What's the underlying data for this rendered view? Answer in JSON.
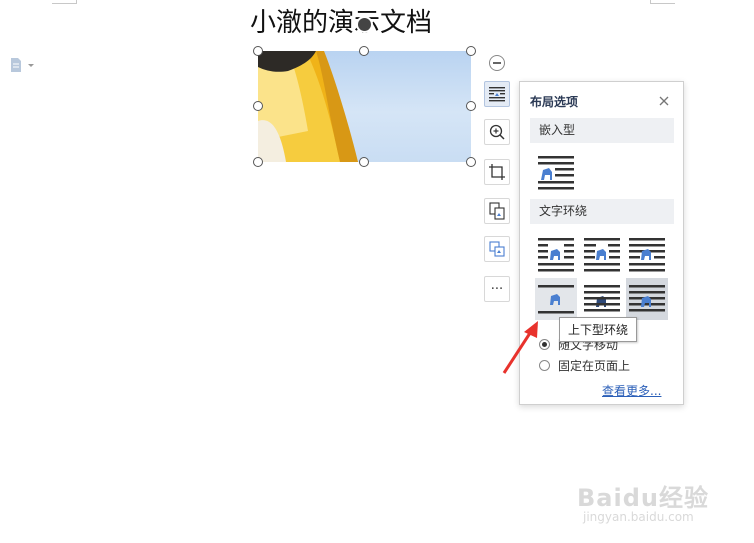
{
  "document": {
    "title": "小澈的演示文档"
  },
  "image_toolbar": {
    "tools": [
      {
        "name": "layout-options",
        "icon": "wrap-text-icon",
        "active": true
      },
      {
        "name": "zoom",
        "icon": "zoom-in-icon"
      },
      {
        "name": "crop",
        "icon": "crop-icon"
      },
      {
        "name": "image-to-text",
        "icon": "image-convert-icon"
      },
      {
        "name": "replace-image",
        "icon": "replace-image-icon"
      },
      {
        "name": "more",
        "icon": "more-icon",
        "label": "···"
      }
    ]
  },
  "layout_panel": {
    "title": "布局选项",
    "inline_section": "嵌入型",
    "wrap_section": "文字环绕",
    "radio_move_with_text": "随文字移动",
    "radio_fix_position": "固定在页面上",
    "more_link": "查看更多...",
    "tooltip": "上下型环绕"
  },
  "watermark": {
    "text": "Baidu经验",
    "url": "jingyan.baidu.com"
  },
  "colors": {
    "accent": "#2b5fb8",
    "icon_blue": "#4a7fd0",
    "arrow_red": "#e8322c"
  }
}
